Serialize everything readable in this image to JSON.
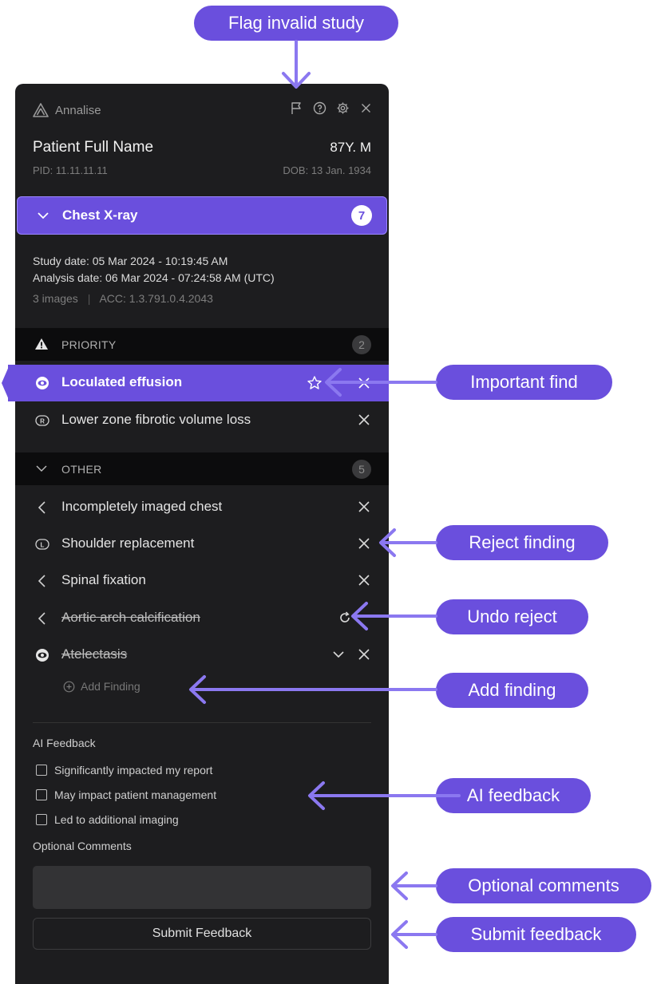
{
  "brand": {
    "name": "Annalise"
  },
  "patient": {
    "name": "Patient Full Name",
    "age_sex": "87Y. M",
    "pid": "PID: 11.11.11.11",
    "dob": "DOB: 13 Jan. 1934"
  },
  "study": {
    "title": "Chest X-ray",
    "count": "7",
    "study_date": "Study date: 05 Mar 2024 - 10:19:45 AM",
    "analysis_date": "Analysis date: 06 Mar 2024 - 07:24:58 AM (UTC)",
    "images": "3 images",
    "acc": "ACC: 1.3.791.0.4.2043"
  },
  "priority": {
    "title": "PRIORITY",
    "count": "2",
    "items": [
      {
        "label": "Loculated effusion",
        "icon": "eye-icon",
        "active": true
      },
      {
        "label": "Lower zone fibrotic volume loss",
        "icon": "r-badge-icon"
      }
    ]
  },
  "other": {
    "title": "OTHER",
    "count": "5",
    "items": [
      {
        "label": "Incompletely imaged chest",
        "icon": "chevron-left-icon"
      },
      {
        "label": "Shoulder replacement",
        "icon": "l-badge-icon"
      },
      {
        "label": "Spinal fixation",
        "icon": "chevron-left-icon"
      },
      {
        "label": "Aortic arch calcification",
        "icon": "chevron-left-icon",
        "rejected": true
      },
      {
        "label": "Atelectasis",
        "icon": "eye-icon",
        "rejected": true
      }
    ],
    "add_label": "Add Finding"
  },
  "feedback": {
    "title": "AI Feedback",
    "options": [
      "Significantly impacted my report",
      "May impact patient management",
      "Led to additional imaging"
    ],
    "comments_title": "Optional Comments",
    "comments_value": "",
    "submit_label": "Submit Feedback"
  },
  "callouts": {
    "flag": "Flag invalid study",
    "important": "Important find",
    "reject": "Reject finding",
    "undo": "Undo reject",
    "add": "Add finding",
    "ai": "AI feedback",
    "comments": "Optional comments",
    "submit": "Submit feedback"
  },
  "colors": {
    "accent": "#6a4fdd",
    "panel": "#1d1d1f",
    "callout_arrow": "#8b78f0"
  }
}
